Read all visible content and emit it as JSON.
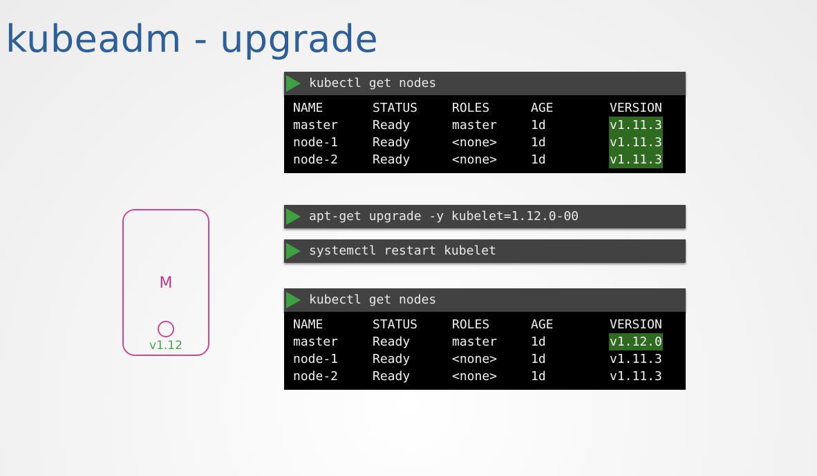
{
  "title": "kubeadm - upgrade",
  "colors": {
    "title": "#2e5f96",
    "accent_green": "#3fa142",
    "highlight_green": "#2e6a1f",
    "node_border": "#d2458f"
  },
  "commands": {
    "get_nodes_1": "kubectl get nodes",
    "apt_upgrade": "apt-get upgrade -y kubelet=1.12.0-00",
    "restart": "systemctl restart kubelet",
    "get_nodes_2": "kubectl get nodes"
  },
  "table_before": {
    "headers": [
      "NAME",
      "STATUS",
      "ROLES",
      "AGE",
      "VERSION"
    ],
    "rows": [
      [
        "master",
        "Ready",
        "master",
        "1d",
        "v1.11.3"
      ],
      [
        "node-1",
        "Ready",
        "<none>",
        "1d",
        "v1.11.3"
      ],
      [
        "node-2",
        "Ready",
        "<none>",
        "1d",
        "v1.11.3"
      ]
    ]
  },
  "table_after": {
    "headers": [
      "NAME",
      "STATUS",
      "ROLES",
      "AGE",
      "VERSION"
    ],
    "rows": [
      [
        "master",
        "Ready",
        "master",
        "1d",
        "v1.12.0"
      ],
      [
        "node-1",
        "Ready",
        "<none>",
        "1d",
        "v1.11.3"
      ],
      [
        "node-2",
        "Ready",
        "<none>",
        "1d",
        "v1.11.3"
      ]
    ]
  },
  "node": {
    "label": "M",
    "version": "v1.12",
    "icon": "kubelet-circle-icon"
  }
}
